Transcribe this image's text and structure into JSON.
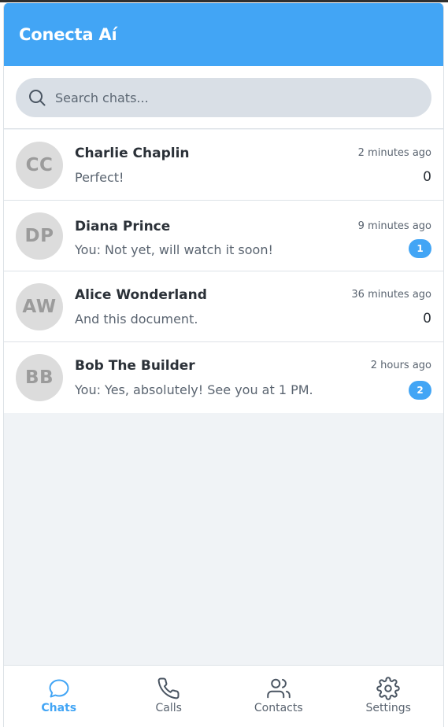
{
  "app": {
    "title": "Conecta Aí",
    "accent_color": "#42a5f5"
  },
  "search": {
    "placeholder": "Search chats...",
    "value": "",
    "icon": "search-icon"
  },
  "chats": [
    {
      "initials": "CC",
      "name": "Charlie Chaplin",
      "preview": "Perfect!",
      "time": "2 minutes ago",
      "unread": "0",
      "unread_style": "plain"
    },
    {
      "initials": "DP",
      "name": "Diana Prince",
      "preview": "You: Not yet, will watch it soon!",
      "time": "9 minutes ago",
      "unread": "1",
      "unread_style": "badge"
    },
    {
      "initials": "AW",
      "name": "Alice Wonderland",
      "preview": "And this document.",
      "time": "36 minutes ago",
      "unread": "0",
      "unread_style": "plain"
    },
    {
      "initials": "BB",
      "name": "Bob The Builder",
      "preview": "You: Yes, absolutely! See you at 1 PM.",
      "time": "2 hours ago",
      "unread": "2",
      "unread_style": "badge"
    }
  ],
  "nav": {
    "chats": {
      "label": "Chats",
      "icon": "chat-bubble-icon",
      "active": true
    },
    "calls": {
      "label": "Calls",
      "icon": "phone-icon",
      "active": false
    },
    "contacts": {
      "label": "Contacts",
      "icon": "users-icon",
      "active": false
    },
    "settings": {
      "label": "Settings",
      "icon": "gear-icon",
      "active": false
    }
  }
}
